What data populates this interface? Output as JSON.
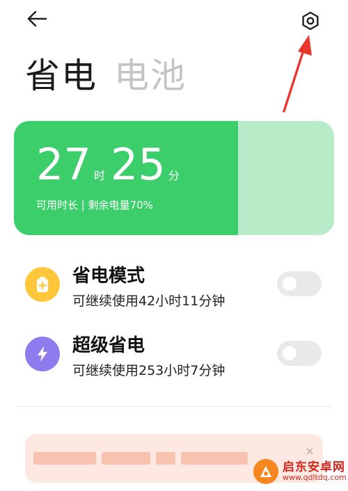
{
  "header": {
    "back_icon": "arrow-left-icon",
    "settings_icon": "gear-icon"
  },
  "tabs": [
    {
      "label": "省电",
      "active": true
    },
    {
      "label": "电池",
      "active": false
    }
  ],
  "battery": {
    "hours": "27",
    "hours_unit": "时",
    "minutes": "25",
    "minutes_unit": "分",
    "subtitle": "可用时长 | 剩余电量70%",
    "level_percent": 70,
    "fill_color": "#3dce6c",
    "empty_color": "#b8ecc8"
  },
  "modes": [
    {
      "title": "省电模式",
      "subtitle": "可继续使用42小时11分钟",
      "icon": "battery-plus-icon",
      "icon_color": "#ffc739",
      "enabled": false
    },
    {
      "title": "超级省电",
      "subtitle": "可继续使用253小时7分钟",
      "icon": "lightning-icon",
      "icon_color": "#8f7bee",
      "enabled": false
    }
  ],
  "annotation_color": "#e8362c",
  "watermark": {
    "title": "启东安卓网",
    "url": "www.qdltdq.com"
  }
}
